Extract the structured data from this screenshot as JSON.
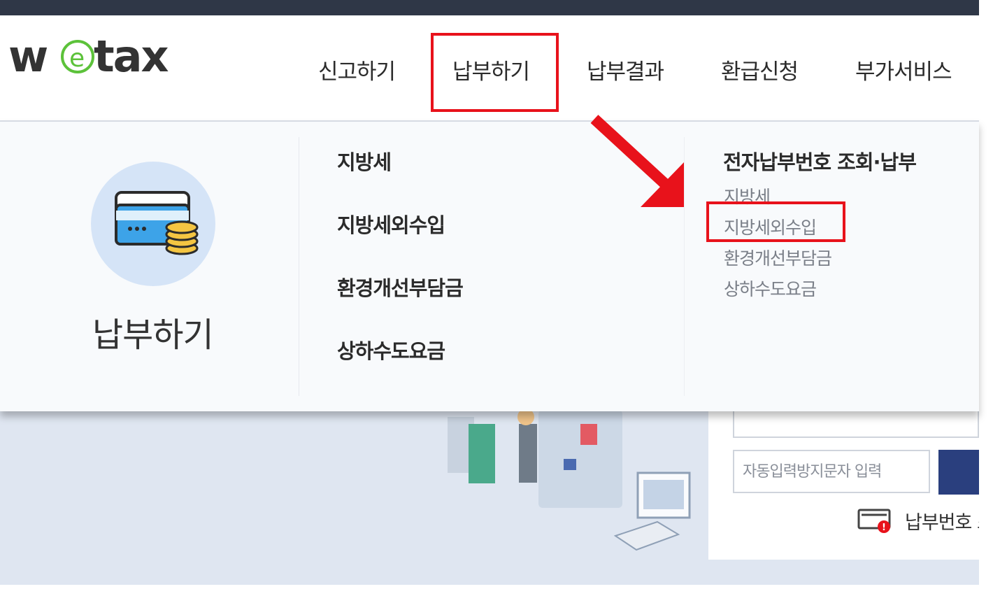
{
  "header": {
    "logo_text": "wetax",
    "nav": [
      {
        "label": "신고하기"
      },
      {
        "label": "납부하기"
      },
      {
        "label": "납부결과"
      },
      {
        "label": "환급신청"
      },
      {
        "label": "부가서비스"
      }
    ]
  },
  "menu": {
    "feature_title": "납부하기",
    "categories": [
      {
        "label": "지방세"
      },
      {
        "label": "지방세외수입"
      },
      {
        "label": "환경개선부담금"
      },
      {
        "label": "상하수도요금"
      }
    ],
    "submenu": {
      "heading": "전자납부번호 조회·납부",
      "items": [
        {
          "label": "지방세"
        },
        {
          "label": "지방세외수입"
        },
        {
          "label": "환경개선부담금"
        },
        {
          "label": "상하수도요금"
        }
      ]
    }
  },
  "background": {
    "captcha_placeholder": "자동입력방지문자 입력",
    "paynum_label": "납부번호 조"
  },
  "colors": {
    "highlight": "#e8121b",
    "topbar": "#2f3747",
    "button": "#2a3f7e",
    "logo_e": "#5cc23a"
  }
}
